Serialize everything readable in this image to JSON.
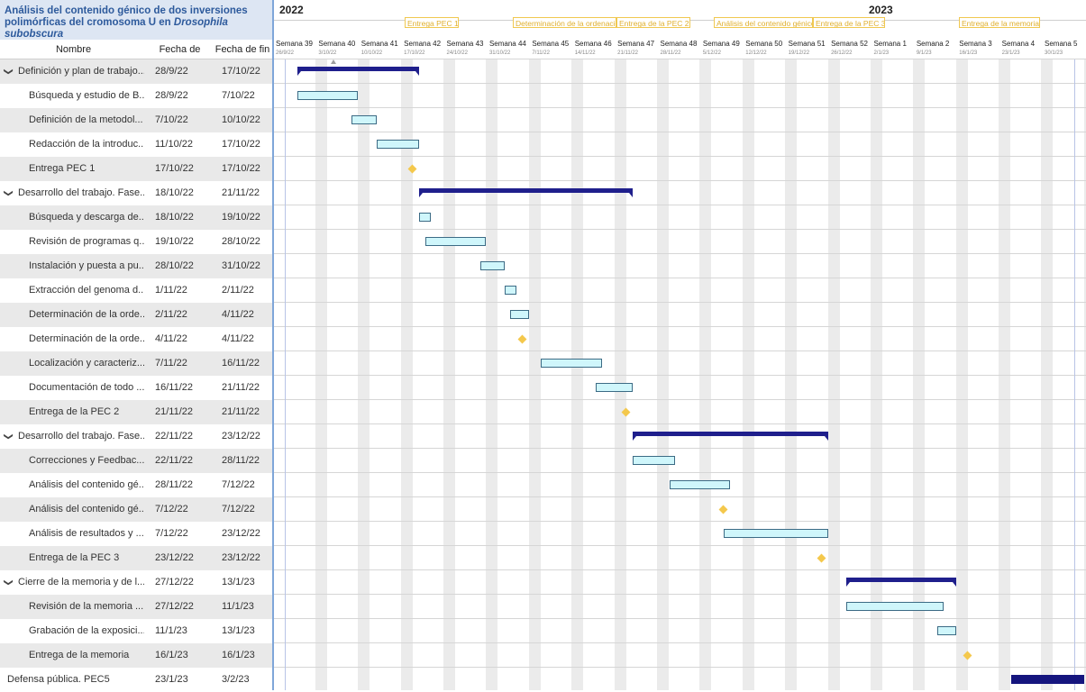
{
  "project_title_line1": "Análisis del contenido génico de dos inversiones",
  "project_title_line2_prefix": "polimórficas del cromosoma U en ",
  "project_title_line2_species": "Drosophila subobscura",
  "columns": {
    "name": "Nombre",
    "start": "Fecha de inicio",
    "end": "Fecha de fin"
  },
  "years": [
    "2022",
    "2023"
  ],
  "milestone_tags": [
    "Entrega PEC 1",
    "Determinación de la ordenación",
    "Entrega de la PEC 2",
    "Análisis del contenido génico",
    "Entrega de la PEC 3",
    "Entrega de la memoria"
  ],
  "weeks": [
    {
      "label": "Semana 39",
      "date": "26/9/22"
    },
    {
      "label": "Semana 40",
      "date": "3/10/22"
    },
    {
      "label": "Semana 41",
      "date": "10/10/22"
    },
    {
      "label": "Semana 42",
      "date": "17/10/22"
    },
    {
      "label": "Semana 43",
      "date": "24/10/22"
    },
    {
      "label": "Semana 44",
      "date": "31/10/22"
    },
    {
      "label": "Semana 45",
      "date": "7/11/22"
    },
    {
      "label": "Semana 46",
      "date": "14/11/22"
    },
    {
      "label": "Semana 47",
      "date": "21/11/22"
    },
    {
      "label": "Semana 48",
      "date": "28/11/22"
    },
    {
      "label": "Semana 49",
      "date": "5/12/22"
    },
    {
      "label": "Semana 50",
      "date": "12/12/22"
    },
    {
      "label": "Semana 51",
      "date": "19/12/22"
    },
    {
      "label": "Semana 52",
      "date": "26/12/22"
    },
    {
      "label": "Semana 1",
      "date": "2/1/23"
    },
    {
      "label": "Semana 2",
      "date": "9/1/23"
    },
    {
      "label": "Semana 3",
      "date": "16/1/23"
    },
    {
      "label": "Semana 4",
      "date": "23/1/23"
    },
    {
      "label": "Semana 5",
      "date": "30/1/23"
    }
  ],
  "tasks": [
    {
      "name": "Definición y plan de trabajo...",
      "start": "28/9/22",
      "end": "17/10/22",
      "kind": "summary",
      "group": true
    },
    {
      "name": "Búsqueda y estudio de B...",
      "start": "28/9/22",
      "end": "7/10/22",
      "kind": "task"
    },
    {
      "name": "Definición de la metodol...",
      "start": "7/10/22",
      "end": "10/10/22",
      "kind": "task"
    },
    {
      "name": "Redacción de la introduc...",
      "start": "11/10/22",
      "end": "17/10/22",
      "kind": "task"
    },
    {
      "name": "Entrega PEC 1",
      "start": "17/10/22",
      "end": "17/10/22",
      "kind": "milestone"
    },
    {
      "name": "Desarrollo del trabajo. Fase...",
      "start": "18/10/22",
      "end": "21/11/22",
      "kind": "summary",
      "group": true
    },
    {
      "name": "Búsqueda y descarga de...",
      "start": "18/10/22",
      "end": "19/10/22",
      "kind": "task"
    },
    {
      "name": "Revisión de programas q...",
      "start": "19/10/22",
      "end": "28/10/22",
      "kind": "task"
    },
    {
      "name": "Instalación y puesta a pu...",
      "start": "28/10/22",
      "end": "31/10/22",
      "kind": "task"
    },
    {
      "name": "Extracción del genoma d...",
      "start": "1/11/22",
      "end": "2/11/22",
      "kind": "task"
    },
    {
      "name": "Determinación de la orde...",
      "start": "2/11/22",
      "end": "4/11/22",
      "kind": "task"
    },
    {
      "name": "Determinación de la orde...",
      "start": "4/11/22",
      "end": "4/11/22",
      "kind": "milestone"
    },
    {
      "name": "Localización y caracteriz...",
      "start": "7/11/22",
      "end": "16/11/22",
      "kind": "task"
    },
    {
      "name": "Documentación de todo ...",
      "start": "16/11/22",
      "end": "21/11/22",
      "kind": "task"
    },
    {
      "name": "Entrega de la PEC 2",
      "start": "21/11/22",
      "end": "21/11/22",
      "kind": "milestone"
    },
    {
      "name": "Desarrollo del trabajo. Fase...",
      "start": "22/11/22",
      "end": "23/12/22",
      "kind": "summary",
      "group": true
    },
    {
      "name": "Correcciones y Feedbac...",
      "start": "22/11/22",
      "end": "28/11/22",
      "kind": "task"
    },
    {
      "name": "Análisis del contenido gé...",
      "start": "28/11/22",
      "end": "7/12/22",
      "kind": "task"
    },
    {
      "name": "Análisis del contenido gé...",
      "start": "7/12/22",
      "end": "7/12/22",
      "kind": "milestone"
    },
    {
      "name": "Análisis de resultados y ...",
      "start": "7/12/22",
      "end": "23/12/22",
      "kind": "task"
    },
    {
      "name": "Entrega de la PEC 3",
      "start": "23/12/22",
      "end": "23/12/22",
      "kind": "milestone"
    },
    {
      "name": "Cierre de la memoria y de l...",
      "start": "27/12/22",
      "end": "13/1/23",
      "kind": "summary",
      "group": true
    },
    {
      "name": "Revisión de la memoria ...",
      "start": "27/12/22",
      "end": "11/1/23",
      "kind": "task"
    },
    {
      "name": "Grabación de la exposici...",
      "start": "11/1/23",
      "end": "13/1/23",
      "kind": "task"
    },
    {
      "name": "Entrega de la memoria",
      "start": "16/1/23",
      "end": "16/1/23",
      "kind": "milestone"
    },
    {
      "name": "Defensa pública. PEC5",
      "start": "23/1/23",
      "end": "3/2/23",
      "kind": "bigbar",
      "group": false
    }
  ]
}
